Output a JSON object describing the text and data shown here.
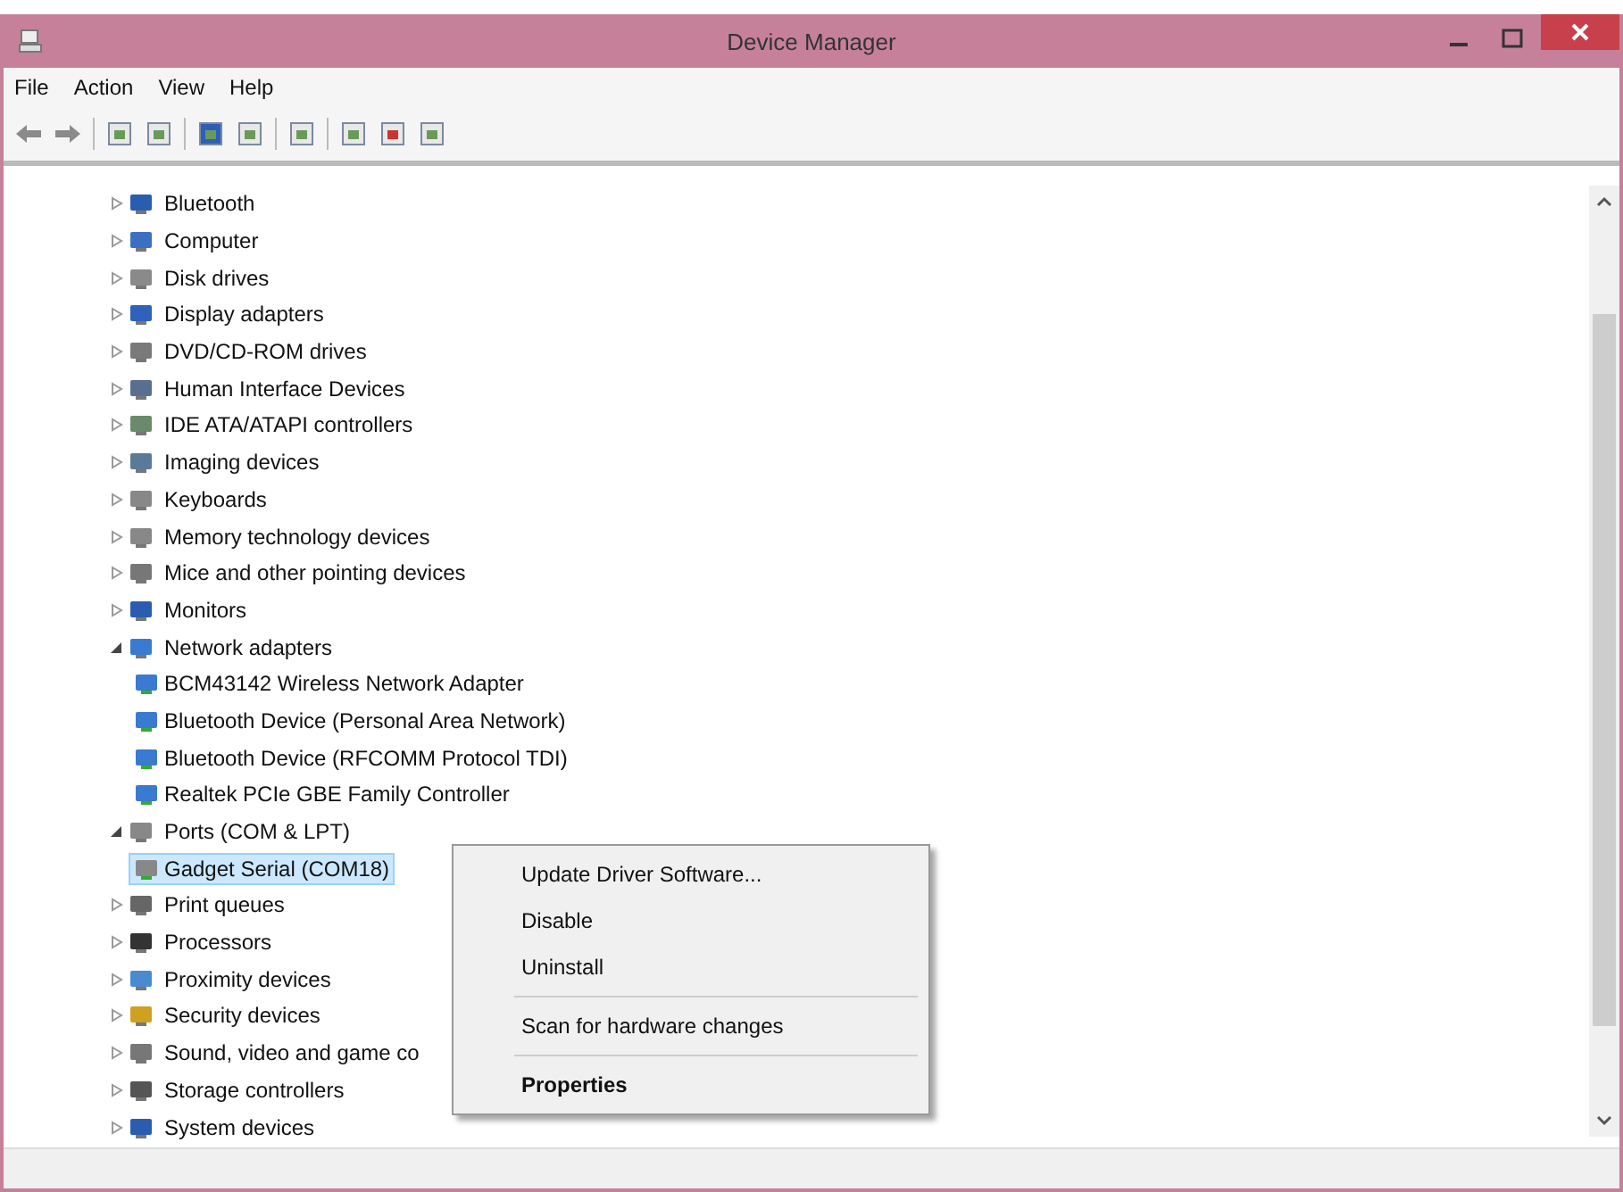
{
  "window": {
    "title": "Device Manager"
  },
  "menu": [
    "File",
    "Action",
    "View",
    "Help"
  ],
  "tree": [
    {
      "label": "Bluetooth",
      "expanded": false,
      "selected": false
    },
    {
      "label": "Computer",
      "expanded": false,
      "selected": false
    },
    {
      "label": "Disk drives",
      "expanded": false,
      "selected": false
    },
    {
      "label": "Display adapters",
      "expanded": false,
      "selected": false
    },
    {
      "label": "DVD/CD-ROM drives",
      "expanded": false,
      "selected": false
    },
    {
      "label": "Human Interface Devices",
      "expanded": false,
      "selected": false
    },
    {
      "label": "IDE ATA/ATAPI controllers",
      "expanded": false,
      "selected": false
    },
    {
      "label": "Imaging devices",
      "expanded": false,
      "selected": false
    },
    {
      "label": "Keyboards",
      "expanded": false,
      "selected": false
    },
    {
      "label": "Memory technology devices",
      "expanded": false,
      "selected": false
    },
    {
      "label": "Mice and other pointing devices",
      "expanded": false,
      "selected": false
    },
    {
      "label": "Monitors",
      "expanded": false,
      "selected": false
    },
    {
      "label": "Network adapters",
      "expanded": true,
      "selected": false,
      "children": [
        {
          "label": "BCM43142 Wireless Network Adapter",
          "selected": false
        },
        {
          "label": "Bluetooth Device (Personal Area Network)",
          "selected": false
        },
        {
          "label": "Bluetooth Device (RFCOMM Protocol TDI)",
          "selected": false
        },
        {
          "label": "Realtek PCIe GBE Family Controller",
          "selected": false
        }
      ]
    },
    {
      "label": "Ports (COM & LPT)",
      "expanded": true,
      "selected": false,
      "children": [
        {
          "label": "Gadget Serial (COM18)",
          "selected": true
        }
      ]
    },
    {
      "label": "Print queues",
      "expanded": false,
      "selected": false
    },
    {
      "label": "Processors",
      "expanded": false,
      "selected": false
    },
    {
      "label": "Proximity devices",
      "expanded": false,
      "selected": false
    },
    {
      "label": "Security devices",
      "expanded": false,
      "selected": false
    },
    {
      "label": "Sound, video and game co",
      "expanded": false,
      "selected": false
    },
    {
      "label": "Storage controllers",
      "expanded": false,
      "selected": false
    },
    {
      "label": "System devices",
      "expanded": false,
      "selected": false
    }
  ],
  "context_menu": [
    {
      "kind": "item",
      "label": "Update Driver Software...",
      "default": false
    },
    {
      "kind": "item",
      "label": "Disable",
      "default": false
    },
    {
      "kind": "item",
      "label": "Uninstall",
      "default": false
    },
    {
      "kind": "separator"
    },
    {
      "kind": "item",
      "label": "Scan for hardware changes",
      "default": false
    },
    {
      "kind": "separator"
    },
    {
      "kind": "item",
      "label": "Properties",
      "default": true
    }
  ]
}
